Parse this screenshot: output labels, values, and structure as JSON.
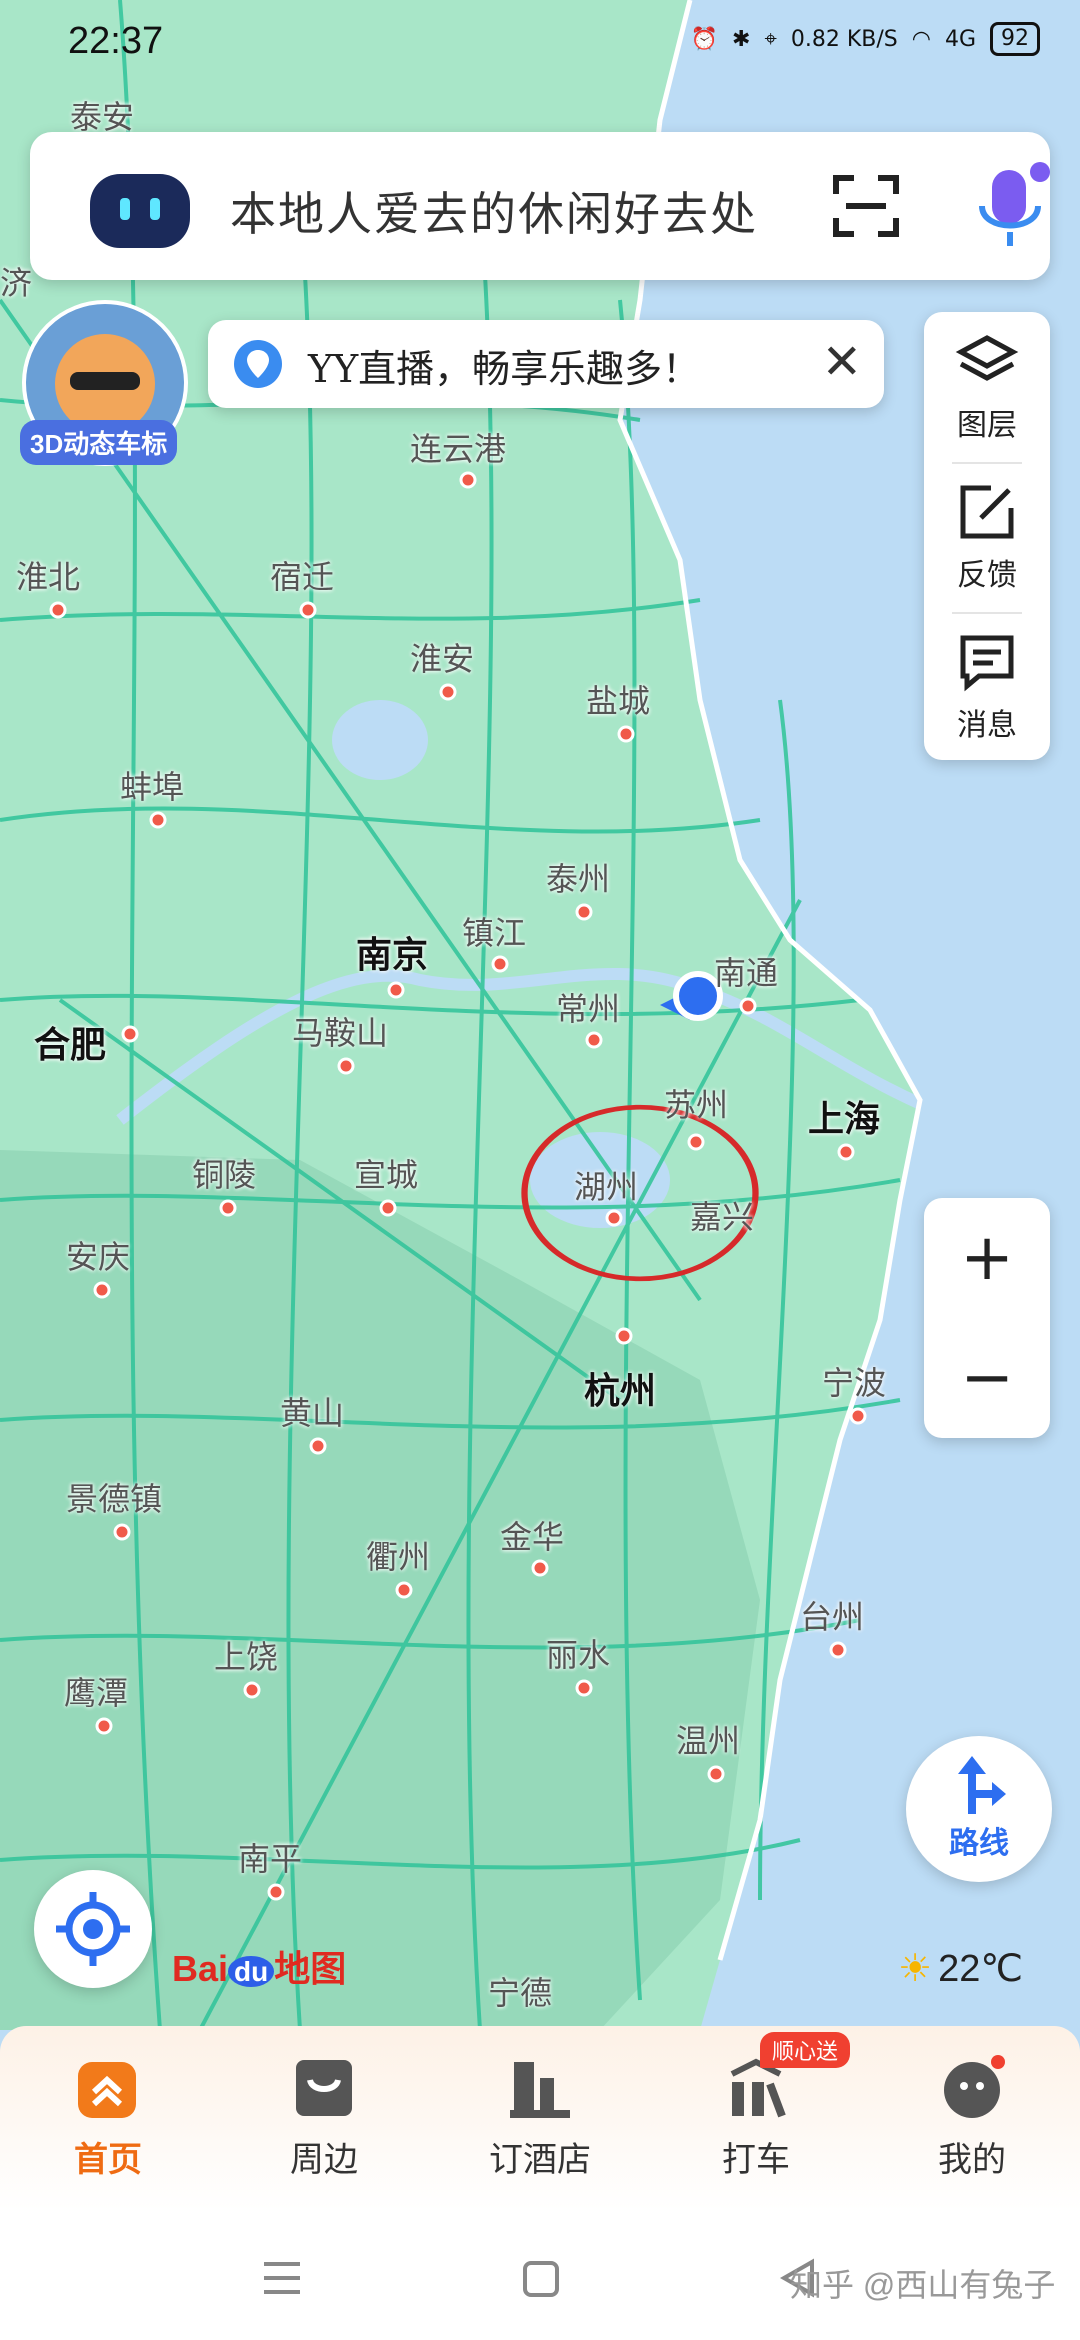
{
  "status_bar": {
    "time": "22:37",
    "net_speed": "0.82 KB/S",
    "network": "4G",
    "battery": "92"
  },
  "search": {
    "placeholder": "本地人爱去的休闲好去处"
  },
  "avatar_label": "3D动态车标",
  "notice": {
    "text": "YY直播，畅享乐趣多！"
  },
  "layers_panel": {
    "items": [
      {
        "label": "图层",
        "icon": "layers-icon"
      },
      {
        "label": "反馈",
        "icon": "feedback-icon"
      },
      {
        "label": "消息",
        "icon": "message-icon"
      }
    ]
  },
  "zoom": {
    "plus": "+",
    "minus": "−"
  },
  "route_button": {
    "label": "路线"
  },
  "map": {
    "cities": [
      {
        "name": "泰安"
      },
      {
        "name": "济"
      },
      {
        "name": "连云港"
      },
      {
        "name": "淮北"
      },
      {
        "name": "宿迁"
      },
      {
        "name": "淮安"
      },
      {
        "name": "盐城"
      },
      {
        "name": "蚌埠"
      },
      {
        "name": "泰州"
      },
      {
        "name": "南京",
        "major": true
      },
      {
        "name": "镇江"
      },
      {
        "name": "南通"
      },
      {
        "name": "常州"
      },
      {
        "name": "合肥",
        "major": true
      },
      {
        "name": "马鞍山"
      },
      {
        "name": "苏州"
      },
      {
        "name": "上海",
        "major": true
      },
      {
        "name": "铜陵"
      },
      {
        "name": "宣城"
      },
      {
        "name": "湖州"
      },
      {
        "name": "嘉兴"
      },
      {
        "name": "安庆"
      },
      {
        "name": "杭州",
        "major": true
      },
      {
        "name": "宁波"
      },
      {
        "name": "黄山"
      },
      {
        "name": "景德镇"
      },
      {
        "name": "金华"
      },
      {
        "name": "衢州"
      },
      {
        "name": "台州"
      },
      {
        "name": "丽水"
      },
      {
        "name": "上饶"
      },
      {
        "name": "鹰潭"
      },
      {
        "name": "温州"
      },
      {
        "name": "南平"
      },
      {
        "name": "宁德"
      }
    ]
  },
  "logo": {
    "part1": "Bai",
    "part2": "du",
    "part3": "地图"
  },
  "weather": {
    "temperature": "22℃"
  },
  "tabs": [
    {
      "label": "首页",
      "active": true
    },
    {
      "label": "周边"
    },
    {
      "label": "订酒店"
    },
    {
      "label": "打车"
    },
    {
      "label": "我的"
    }
  ],
  "taxi_badge": "顺心送",
  "watermark": "知乎 @西山有兔子",
  "colors": {
    "land": "#a8e6c8",
    "road": "#36c59c",
    "water": "#bcdcf5",
    "accent": "#ef6b12",
    "blue": "#2d6ef0",
    "annotation": "#d62a2a"
  }
}
